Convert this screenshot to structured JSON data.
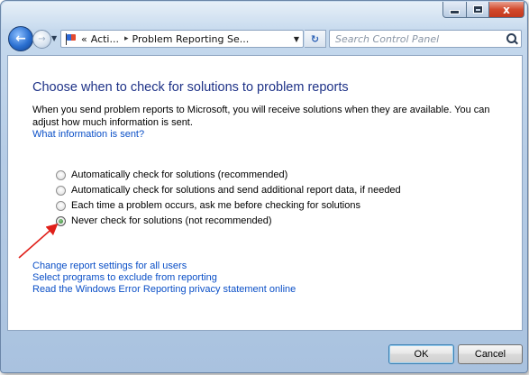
{
  "window": {
    "minimize_label": "–",
    "maximize_label": "□",
    "close_label": "x"
  },
  "nav": {
    "back_icon": "back-arrow-icon",
    "forward_icon": "forward-arrow-icon",
    "address": {
      "prefix": "«",
      "crumb1": "Acti...",
      "crumb_separator": "▸",
      "crumb2": "Problem Reporting Se..."
    },
    "search_placeholder": "Search Control Panel"
  },
  "main": {
    "title": "Choose when to check for solutions to problem reports",
    "description": "When you send problem reports to Microsoft, you will receive solutions when they are available. You can adjust how much information is sent.",
    "info_link": "What information is sent?",
    "options": [
      {
        "label": "Automatically check for solutions (recommended)",
        "selected": false
      },
      {
        "label": "Automatically check for solutions and send additional report data, if needed",
        "selected": false
      },
      {
        "label": "Each time a problem occurs, ask me before checking for solutions",
        "selected": false
      },
      {
        "label": "Never check for solutions (not recommended)",
        "selected": true
      }
    ],
    "links": [
      "Change report settings for all users",
      "Select programs to exclude from reporting",
      "Read the Windows Error Reporting privacy statement online"
    ]
  },
  "footer": {
    "ok_label": "OK",
    "cancel_label": "Cancel"
  },
  "colors": {
    "title": "#1e3287",
    "link": "#0a4fc7",
    "annotation_arrow": "#e0201a"
  }
}
